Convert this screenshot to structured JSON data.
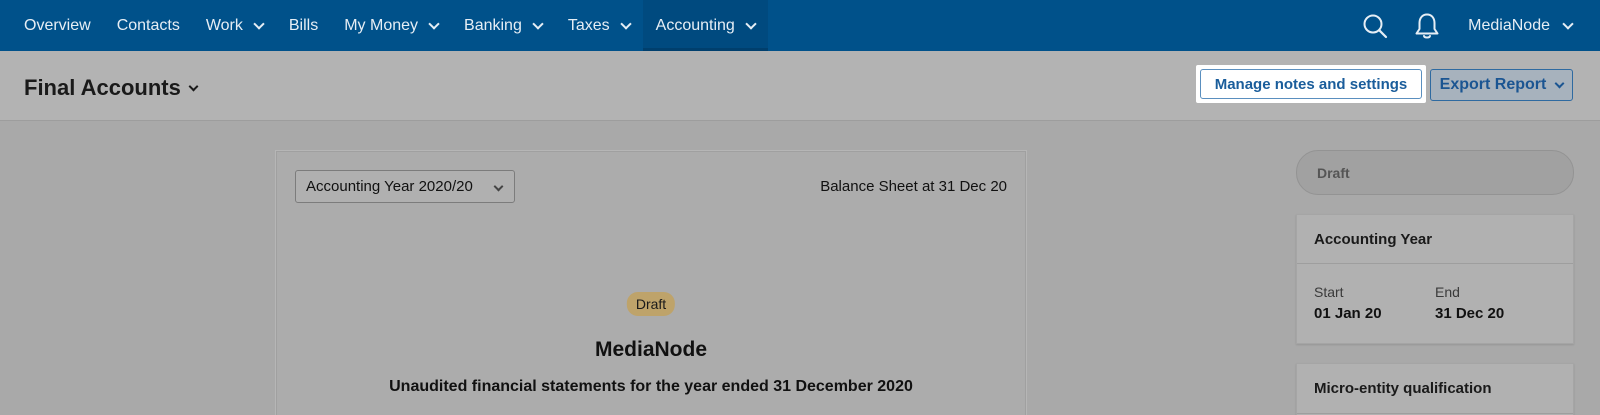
{
  "nav": {
    "items": [
      {
        "label": "Overview",
        "dropdown": false,
        "active": false
      },
      {
        "label": "Contacts",
        "dropdown": false,
        "active": false
      },
      {
        "label": "Work",
        "dropdown": true,
        "active": false
      },
      {
        "label": "Bills",
        "dropdown": false,
        "active": false
      },
      {
        "label": "My Money",
        "dropdown": true,
        "active": false
      },
      {
        "label": "Banking",
        "dropdown": true,
        "active": false
      },
      {
        "label": "Taxes",
        "dropdown": true,
        "active": false
      },
      {
        "label": "Accounting",
        "dropdown": true,
        "active": true
      }
    ],
    "user": "MediaNode",
    "icons": [
      "search-icon",
      "bell-icon"
    ]
  },
  "header": {
    "title": "Final Accounts",
    "manage_label": "Manage notes and settings",
    "export_label": "Export Report"
  },
  "report": {
    "year_select": "Accounting Year 2020/20",
    "balance_label": "Balance Sheet at 31 Dec 20",
    "badge": "Draft",
    "company": "MediaNode",
    "statement": "Unaudited financial statements for the year ended 31 December 2020"
  },
  "sidebar": {
    "status": "Draft",
    "year_card": {
      "title": "Accounting Year",
      "start_label": "Start",
      "start_value": "01 Jan 20",
      "end_label": "End",
      "end_value": "31 Dec 20"
    },
    "micro_card": {
      "title": "Micro-entity qualification"
    }
  },
  "colors": {
    "nav_bg": "#00518a",
    "accent": "#1a5d9b",
    "draft_badge": "#bea36a"
  }
}
